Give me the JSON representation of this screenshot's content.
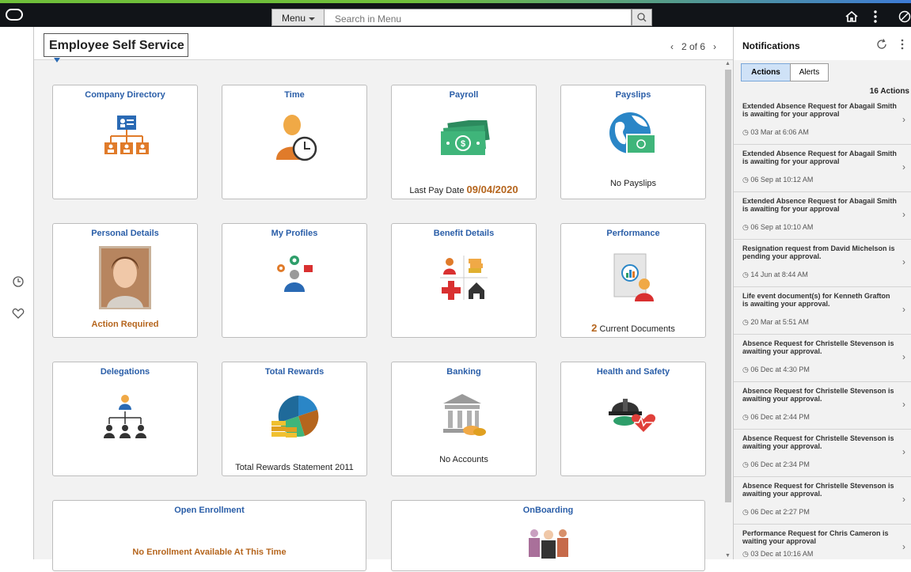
{
  "header": {
    "menu_label": "Menu",
    "search_placeholder": "Search in Menu"
  },
  "main": {
    "homepage_title": "Employee Self Service",
    "pager": "2 of 6"
  },
  "tiles": [
    {
      "title": "Company Directory",
      "icon": "org-chart-icon"
    },
    {
      "title": "Time",
      "icon": "person-clock-icon"
    },
    {
      "title": "Payroll",
      "icon": "money-icon",
      "footer_label": "Last Pay Date",
      "footer_value": "09/04/2020"
    },
    {
      "title": "Payslips",
      "icon": "globe-money-icon",
      "footer": "No Payslips"
    },
    {
      "title": "Personal Details",
      "icon": "photo-icon",
      "footer": "Action Required"
    },
    {
      "title": "My Profiles",
      "icon": "profiles-icon"
    },
    {
      "title": "Benefit Details",
      "icon": "benefits-icon"
    },
    {
      "title": "Performance",
      "icon": "document-chart-icon",
      "footer_value": "2",
      "footer_label": "Current Documents"
    },
    {
      "title": "Delegations",
      "icon": "delegation-icon"
    },
    {
      "title": "Total Rewards",
      "icon": "pie-coins-icon",
      "footer": "Total Rewards Statement 2011"
    },
    {
      "title": "Banking",
      "icon": "bank-icon",
      "footer": "No Accounts"
    },
    {
      "title": "Health and Safety",
      "icon": "hardhat-heart-icon"
    },
    {
      "title": "Open Enrollment",
      "footer": "No Enrollment Available At This Time"
    },
    {
      "title": "OnBoarding",
      "icon": "team-icon"
    }
  ],
  "notifications": {
    "title": "Notifications",
    "tabs": [
      "Actions",
      "Alerts"
    ],
    "count": "16 Actions",
    "items": [
      {
        "text": "Extended Absence Request for Abagail Smith is awaiting for your approval",
        "date": "03 Mar at 6:06 AM"
      },
      {
        "text": "Extended Absence Request for Abagail Smith is awaiting for your approval",
        "date": "06 Sep at 10:12 AM"
      },
      {
        "text": "Extended Absence Request for Abagail Smith is awaiting for your approval",
        "date": "06 Sep at 10:10 AM"
      },
      {
        "text": "Resignation request from David Michelson is pending your approval.",
        "date": "14 Jun at 8:44 AM"
      },
      {
        "text": "Life event document(s) for Kenneth Grafton is awaiting your approval.",
        "date": "20 Mar at 5:51 AM"
      },
      {
        "text": "Absence Request for Christelle Stevenson is awaiting your approval.",
        "date": "06 Dec at 4:30 PM"
      },
      {
        "text": "Absence Request for Christelle Stevenson is awaiting your approval.",
        "date": "06 Dec at 2:44 PM"
      },
      {
        "text": "Absence Request for Christelle Stevenson is awaiting your approval.",
        "date": "06 Dec at 2:34 PM"
      },
      {
        "text": "Absence Request for Christelle Stevenson is awaiting your approval.",
        "date": "06 Dec at 2:27 PM"
      },
      {
        "text": "Performance Request for Chris Cameron is waiting your approval",
        "date": "03 Dec at 10:16 AM"
      }
    ]
  },
  "colors": {
    "accent": "#2a5ea8",
    "orange": "#e07b2a",
    "green": "#2e9e6a",
    "status": "#b5651d"
  }
}
